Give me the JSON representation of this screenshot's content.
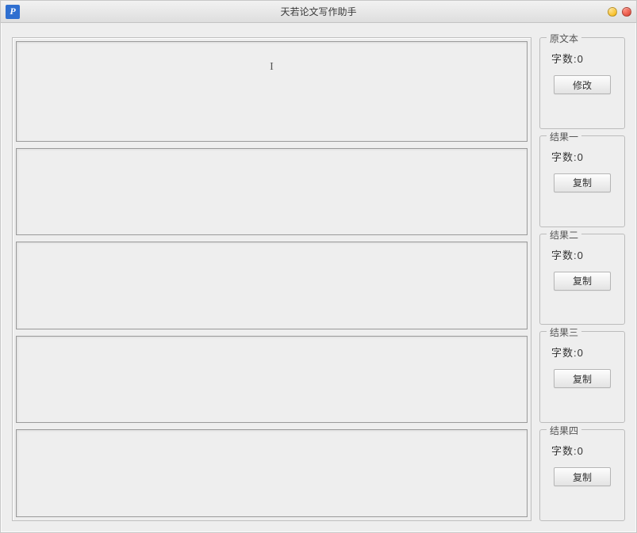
{
  "window": {
    "title": "天若论文写作助手",
    "app_icon_letter": "P"
  },
  "labels": {
    "count_prefix": "字数:"
  },
  "panels": [
    {
      "legend": "原文本",
      "count": 0,
      "button": "修改"
    },
    {
      "legend": "结果一",
      "count": 0,
      "button": "复制"
    },
    {
      "legend": "结果二",
      "count": 0,
      "button": "复制"
    },
    {
      "legend": "结果三",
      "count": 0,
      "button": "复制"
    },
    {
      "legend": "结果四",
      "count": 0,
      "button": "复制"
    }
  ]
}
